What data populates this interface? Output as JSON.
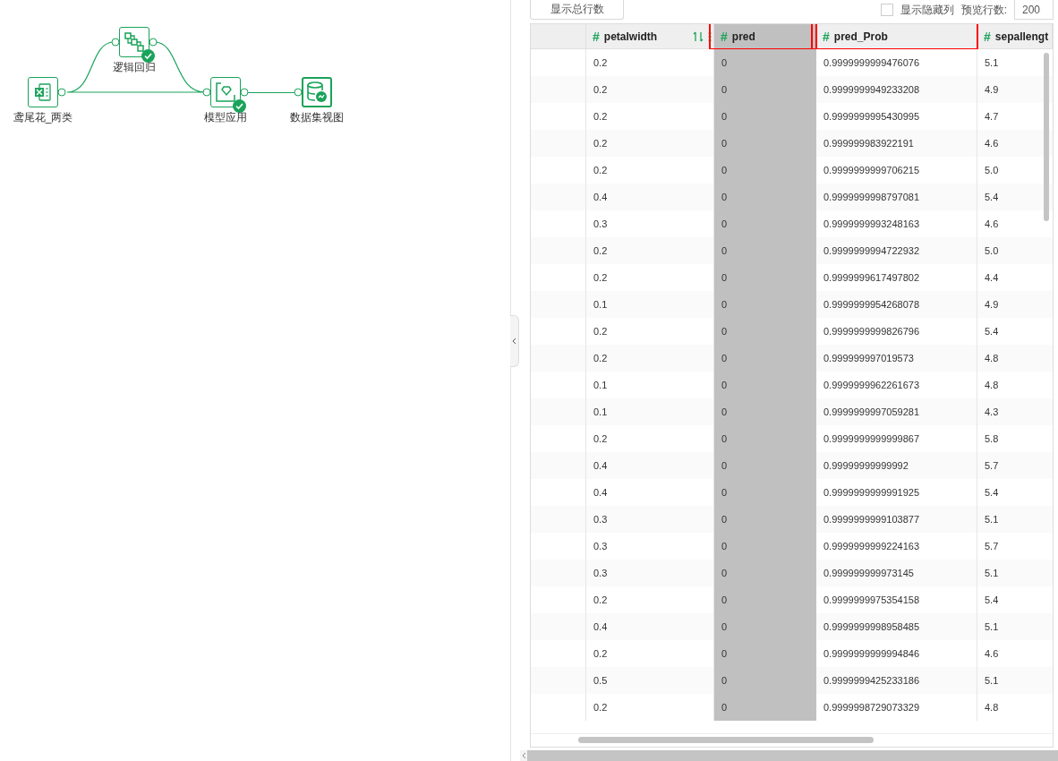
{
  "flow": {
    "nodes": [
      {
        "label": "鸢尾花_两类",
        "kind": "excel",
        "done": false,
        "selected": false
      },
      {
        "label": "逻辑回归",
        "kind": "logistic",
        "done": true,
        "selected": false
      },
      {
        "label": "模型应用",
        "kind": "model",
        "done": true,
        "selected": false
      },
      {
        "label": "数据集视图",
        "kind": "dataview",
        "done": false,
        "selected": true
      }
    ]
  },
  "toolbar": {
    "total_rows_button": "显示总行数",
    "show_hidden_columns": {
      "label": "显示隐藏列",
      "checked": false
    },
    "preview_rows_label": "预览行数:",
    "preview_rows_value": "200"
  },
  "table": {
    "columns": [
      {
        "label": "petalwidth",
        "type_mark": "#",
        "highlighted": false,
        "annotated": false,
        "tools": true
      },
      {
        "label": "pred",
        "type_mark": "#",
        "highlighted": true,
        "annotated": true,
        "tools": false
      },
      {
        "label": "pred_Prob",
        "type_mark": "#",
        "highlighted": false,
        "annotated": true,
        "tools": false
      },
      {
        "label": "sepallengt",
        "type_mark": "#",
        "highlighted": false,
        "annotated": false,
        "tools": false
      }
    ],
    "rows": [
      [
        "0.2",
        "0",
        "0.9999999999476076",
        "5.1"
      ],
      [
        "0.2",
        "0",
        "0.9999999949233208",
        "4.9"
      ],
      [
        "0.2",
        "0",
        "0.9999999995430995",
        "4.7"
      ],
      [
        "0.2",
        "0",
        "0.999999983922191",
        "4.6"
      ],
      [
        "0.2",
        "0",
        "0.9999999999706215",
        "5.0"
      ],
      [
        "0.4",
        "0",
        "0.9999999998797081",
        "5.4"
      ],
      [
        "0.3",
        "0",
        "0.9999999993248163",
        "4.6"
      ],
      [
        "0.2",
        "0",
        "0.9999999994722932",
        "5.0"
      ],
      [
        "0.2",
        "0",
        "0.9999999617497802",
        "4.4"
      ],
      [
        "0.1",
        "0",
        "0.9999999954268078",
        "4.9"
      ],
      [
        "0.2",
        "0",
        "0.9999999999826796",
        "5.4"
      ],
      [
        "0.2",
        "0",
        "0.999999997019573",
        "4.8"
      ],
      [
        "0.1",
        "0",
        "0.9999999962261673",
        "4.8"
      ],
      [
        "0.1",
        "0",
        "0.9999999997059281",
        "4.3"
      ],
      [
        "0.2",
        "0",
        "0.9999999999999867",
        "5.8"
      ],
      [
        "0.4",
        "0",
        "0.99999999999992",
        "5.7"
      ],
      [
        "0.4",
        "0",
        "0.9999999999991925",
        "5.4"
      ],
      [
        "0.3",
        "0",
        "0.9999999999103877",
        "5.1"
      ],
      [
        "0.3",
        "0",
        "0.9999999999224163",
        "5.7"
      ],
      [
        "0.3",
        "0",
        "0.999999999973145",
        "5.1"
      ],
      [
        "0.2",
        "0",
        "0.9999999975354158",
        "5.4"
      ],
      [
        "0.4",
        "0",
        "0.9999999998958485",
        "5.1"
      ],
      [
        "0.2",
        "0",
        "0.9999999999994846",
        "4.6"
      ],
      [
        "0.5",
        "0",
        "0.9999999425233186",
        "5.1"
      ],
      [
        "0.2",
        "0",
        "0.9999998729073329",
        "4.8"
      ]
    ]
  }
}
